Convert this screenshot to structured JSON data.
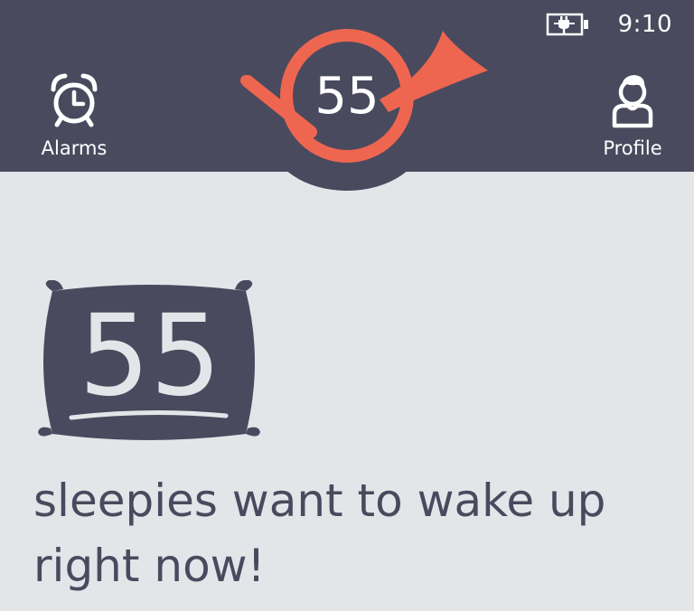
{
  "status_bar": {
    "time": "9:10",
    "battery_icon": "battery-charging-icon"
  },
  "nav": {
    "alarms": {
      "label": "Alarms",
      "icon": "alarm-clock-icon"
    },
    "profile": {
      "label": "Profile",
      "icon": "person-icon"
    }
  },
  "header_badge": {
    "count": "55",
    "icon": "post-horn-icon"
  },
  "main": {
    "count": "55",
    "icon": "pillow-icon",
    "message": "sleepies want to wake up right now!"
  },
  "colors": {
    "header_bg": "#4a4a5e",
    "accent": "#ef6650",
    "page_bg": "#e3e6e9",
    "text_dark": "#4a4a5e"
  }
}
